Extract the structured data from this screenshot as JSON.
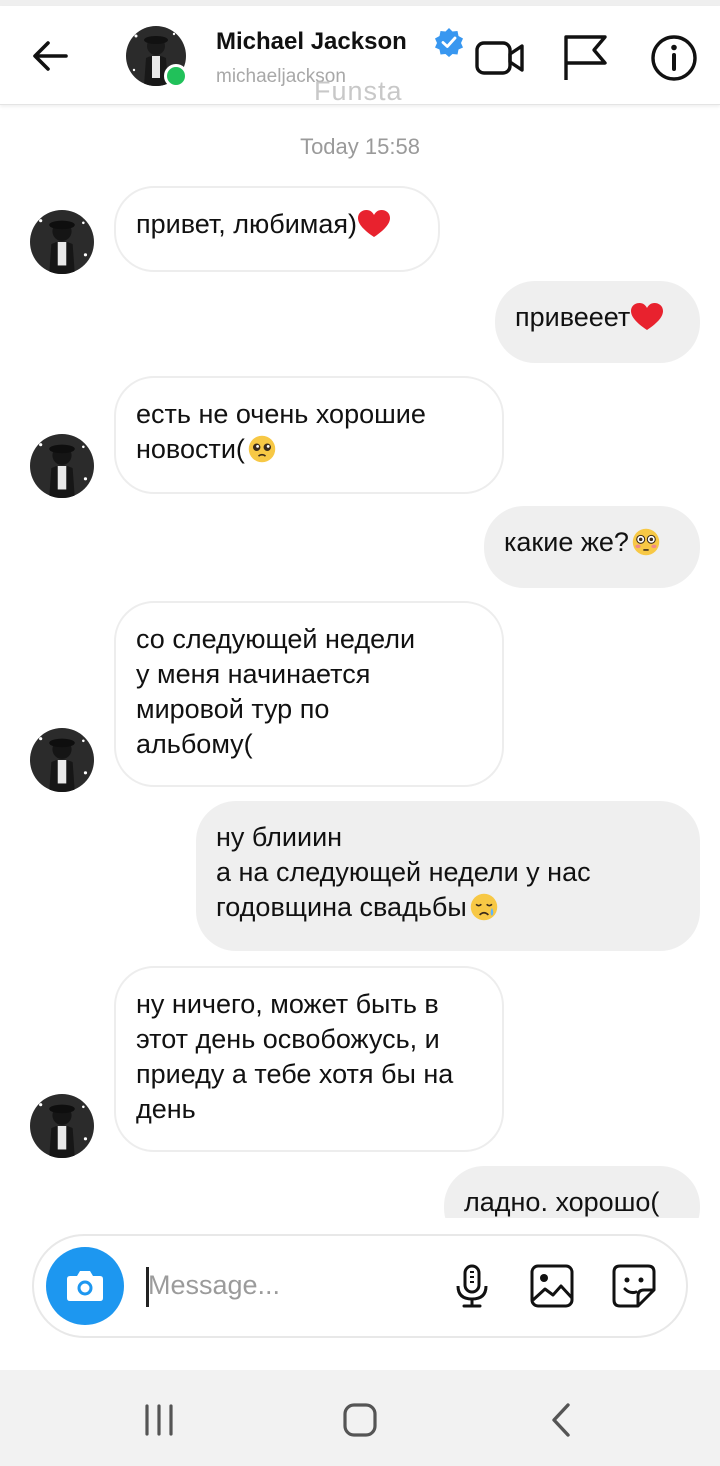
{
  "header": {
    "name": "Michael Jackson",
    "handle": "michaeljackson",
    "watermark": "Funsta"
  },
  "timestamp": "Today 15:58",
  "messages": [
    {
      "side": "in",
      "lines": [
        "привет, любимая)"
      ],
      "emoji": "heart"
    },
    {
      "side": "out",
      "lines": [
        "привееет"
      ],
      "emoji": "heart"
    },
    {
      "side": "in",
      "lines": [
        "есть не очень хорошие",
        "новости("
      ],
      "emoji": "pleading"
    },
    {
      "side": "out",
      "lines": [
        "какие же?"
      ],
      "emoji": "flushed"
    },
    {
      "side": "in",
      "lines": [
        "со следующей недели",
        "у меня начинается",
        "мировой тур по",
        "альбому("
      ],
      "emoji": ""
    },
    {
      "side": "out",
      "lines": [
        "ну блииин",
        "а на следующей недели у нас",
        "годовщина свадьбы"
      ],
      "emoji": "sad"
    },
    {
      "side": "in",
      "lines": [
        "ну ничего, может быть в",
        "этот день освобожусь, и",
        "приеду а тебе хотя бы на",
        "день"
      ],
      "emoji": ""
    },
    {
      "side": "out",
      "lines": [
        "ладно. хорошо("
      ],
      "emoji": ""
    }
  ],
  "composer": {
    "placeholder": "Message..."
  },
  "colors": {
    "accent": "#1d97f0",
    "online": "#21c15a",
    "heart": "#e8222e",
    "outgoing_bubble": "#efefef"
  },
  "icons": [
    "back-arrow-icon",
    "verified-badge-icon",
    "video-call-icon",
    "flag-icon",
    "info-icon",
    "camera-icon",
    "microphone-icon",
    "gallery-icon",
    "sticker-icon",
    "recent-apps-icon",
    "home-icon",
    "nav-back-icon"
  ]
}
